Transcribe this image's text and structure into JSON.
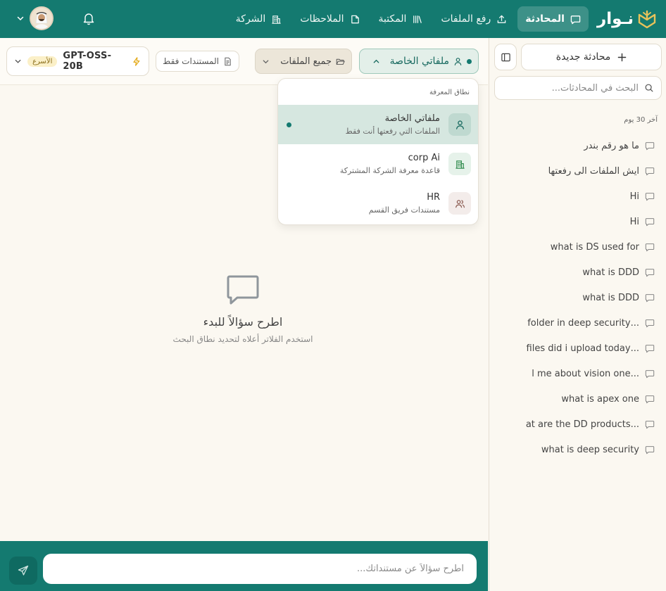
{
  "brand": {
    "logo_text": "نـوار",
    "accent": "#147a70"
  },
  "nav": {
    "items": [
      {
        "label": "المحادثة",
        "icon": "chat-icon",
        "active": true
      },
      {
        "label": "رفع الملفات",
        "icon": "upload-icon",
        "active": false
      },
      {
        "label": "المكتبة",
        "icon": "library-icon",
        "active": false
      },
      {
        "label": "الملاحظات",
        "icon": "note-icon",
        "active": false
      },
      {
        "label": "الشركة",
        "icon": "building-icon",
        "active": false
      }
    ]
  },
  "sidebar": {
    "new_chat_label": "محادثة جديدة",
    "search_placeholder": "البحث في المحادثات...",
    "group_label": "آخر 30 يوم",
    "conversations": [
      "ما هو رقم بندر",
      "ايش الملفات الى رفعتها",
      "Hi",
      "Hi",
      "what is DS used for",
      "what is DDD",
      "what is DDD",
      "...folder in deep security",
      "...files did i upload today",
      "...l me about vision one",
      "what is apex one",
      "...at are the DD products",
      "what is deep security"
    ]
  },
  "toolbar": {
    "model_name": "GPT-OSS-20B",
    "model_badge": "الأسرع",
    "docs_only_label": "المستندات فقط",
    "files_filter_label": "جميع الملفات",
    "scope_label": "ملفاتي الخاصة"
  },
  "dropdown": {
    "header": "نطاق المعرفة",
    "options": [
      {
        "title": "ملفاتي الخاصة",
        "desc": "الملفات التي رفعتها أنت فقط",
        "icon": "user-icon",
        "selected": true
      },
      {
        "title": "corp Ai",
        "desc": "قاعدة معرفة الشركة المشتركة",
        "icon": "building-icon",
        "selected": false
      },
      {
        "title": "HR",
        "desc": "مستندات فريق القسم",
        "icon": "users-icon",
        "selected": false
      }
    ]
  },
  "empty_state": {
    "title": "اطرح سؤالاً للبدء",
    "subtitle": "استخدم الفلاتر أعلاه لتحديد نطاق البحث"
  },
  "composer": {
    "placeholder": "اطرح سؤالاً عن مستنداتك..."
  }
}
